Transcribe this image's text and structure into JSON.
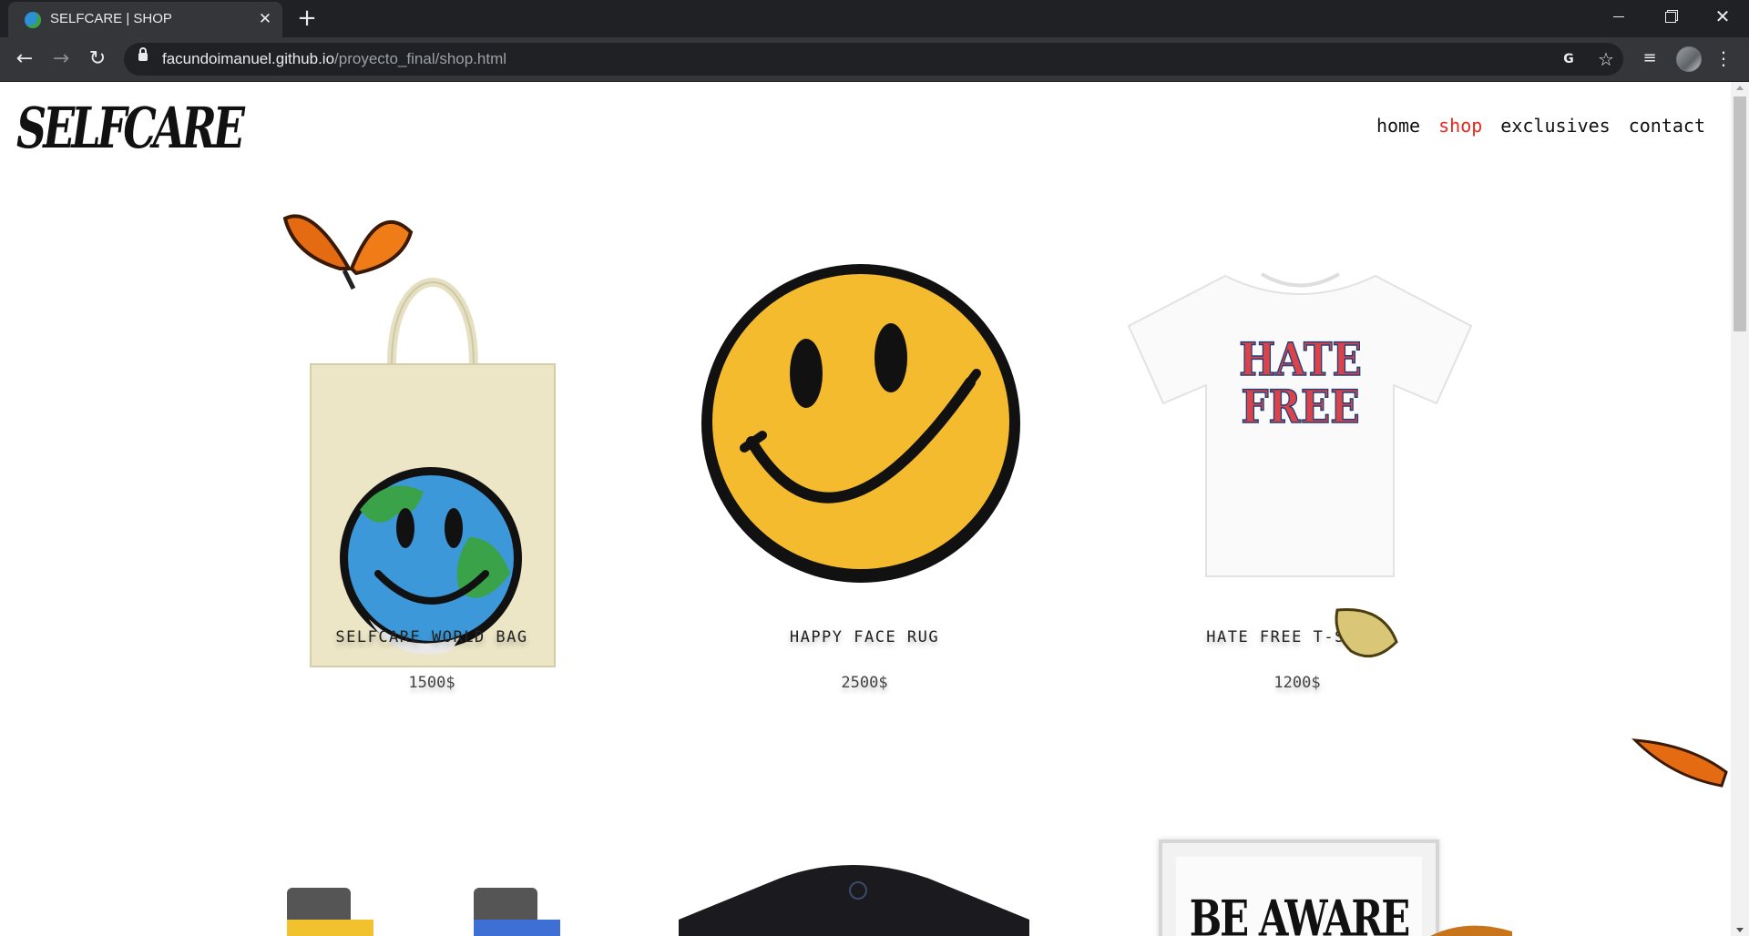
{
  "browser": {
    "tab_title": "SELFCARE | SHOP",
    "url_host": "facundoimanuel.github.io",
    "url_path": "/proyecto_final/shop.html"
  },
  "site": {
    "logo_text": "SELFCARE",
    "nav": [
      {
        "label": "home",
        "active": false
      },
      {
        "label": "shop",
        "active": true
      },
      {
        "label": "exclusives",
        "active": false
      },
      {
        "label": "contact",
        "active": false
      }
    ],
    "accent_color": "#e8271c"
  },
  "products": [
    {
      "name": "SELFCARE WORLD BAG",
      "price": "1500$",
      "image": "tote-bag-smiley-earth"
    },
    {
      "name": "HAPPY FACE RUG",
      "price": "2500$",
      "image": "smiley-rug"
    },
    {
      "name": "HATE FREE T-SHIRT",
      "price": "1200$",
      "image": "white-tshirt-hate-free",
      "print_text": [
        "HATE",
        "FREE"
      ]
    }
  ],
  "second_row": [
    {
      "image": "lighters"
    },
    {
      "image": "black-tshirt"
    },
    {
      "image": "framed-poster-be-aware",
      "poster_text": "BE AWARE"
    }
  ]
}
